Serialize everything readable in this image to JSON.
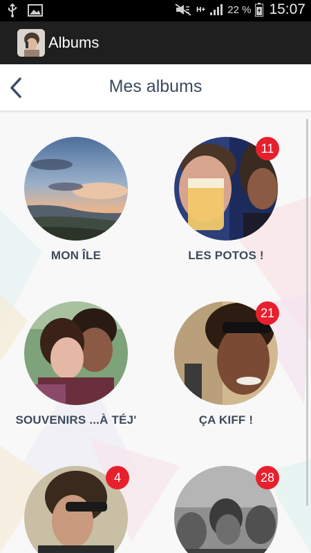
{
  "status_bar": {
    "battery_percent": "22 %",
    "network": "H+",
    "time": "15:07"
  },
  "app_bar": {
    "title": "Albums"
  },
  "header": {
    "title": "Mes albums"
  },
  "albums": [
    {
      "label": "MON ÎLE",
      "badge": ""
    },
    {
      "label": "LES POTOS !",
      "badge": "11"
    },
    {
      "label": "SOUVENIRS ...À TÉJ'",
      "badge": ""
    },
    {
      "label": "ÇA KIFF !",
      "badge": "21"
    },
    {
      "label": "",
      "badge": "4"
    },
    {
      "label": "",
      "badge": "28"
    }
  ],
  "colors": {
    "status_bar": "#000000",
    "action_bar": "#1f1f1f",
    "title_text": "#3a4a5f",
    "badge": "#e8202d"
  }
}
